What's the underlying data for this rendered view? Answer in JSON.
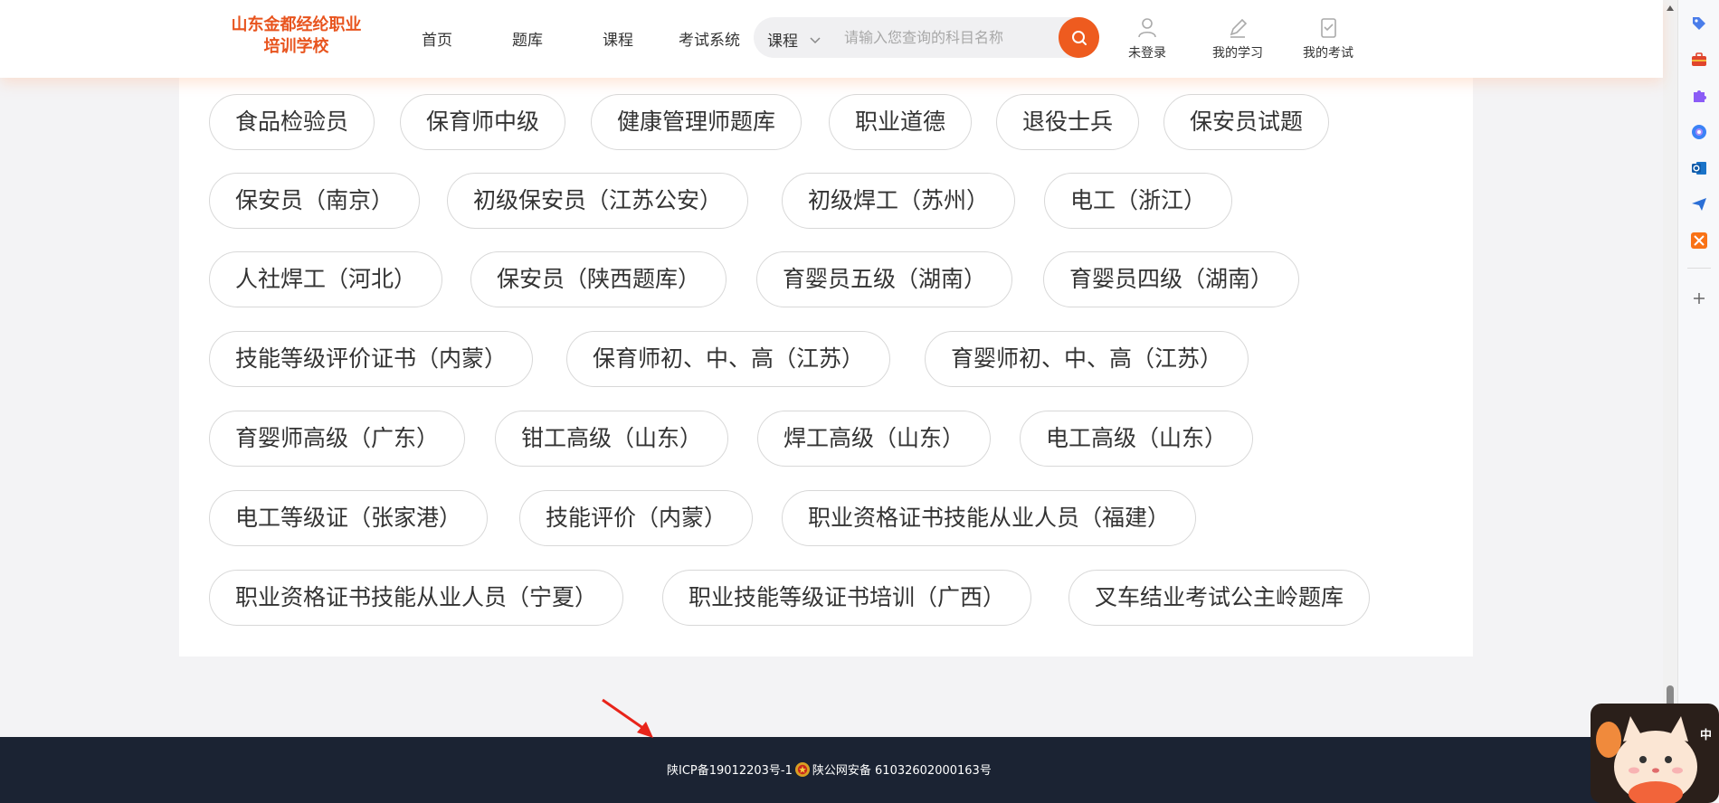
{
  "header": {
    "logo_line1": "山东金都经纶职业",
    "logo_line2": "培训学校",
    "nav": [
      "首页",
      "题库",
      "课程",
      "考试系统"
    ],
    "search": {
      "type_label": "课程",
      "placeholder": "请输入您查询的科目名称"
    },
    "user_links": [
      {
        "label": "未登录",
        "icon": "user-icon"
      },
      {
        "label": "我的学习",
        "icon": "pencil-icon"
      },
      {
        "label": "我的考试",
        "icon": "exam-icon"
      }
    ]
  },
  "tags": [
    "食品检验员",
    "保育师中级",
    "健康管理师题库",
    "职业道德",
    "退役士兵",
    "保安员试题",
    "保安员（南京）",
    "初级保安员（江苏公安）",
    "初级焊工（苏州）",
    "电工（浙江）",
    "人社焊工（河北）",
    "保安员（陕西题库）",
    "育婴员五级（湖南）",
    "育婴员四级（湖南）",
    "技能等级评价证书（内蒙）",
    "保育师初、中、高（江苏）",
    "育婴师初、中、高（江苏）",
    "育婴师高级（广东）",
    "钳工高级（山东）",
    "焊工高级（山东）",
    "电工高级（山东）",
    "电工等级证（张家港）",
    "技能评价（内蒙）",
    "职业资格证书技能从业人员（福建）",
    "职业资格证书技能从业人员（宁夏）",
    "职业技能等级证书培训（广西）",
    "叉车结业考试公主岭题库"
  ],
  "footer": {
    "icp": "陕ICP备19012203号-1",
    "police": "陕公网安备 61032602000163号"
  },
  "mascot": {
    "label": "中"
  },
  "colors": {
    "brand": "#e8541e",
    "search_button": "#ee5b1f",
    "footer_bg": "#1b2333",
    "annotation_arrow": "#e8241a"
  },
  "side_panel_icons": [
    "tag-icon",
    "toolbox-icon",
    "puzzle-icon",
    "copilot-icon",
    "outlook-icon",
    "send-icon",
    "tools-icon",
    "add-icon"
  ]
}
